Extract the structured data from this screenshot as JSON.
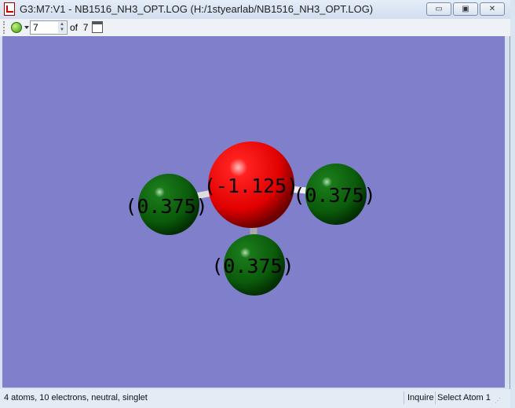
{
  "window": {
    "title": "G3:M7:V1 - NB1516_NH3_OPT.LOG (H:/1styearlab/NB1516_NH3_OPT.LOG)",
    "minimize": "▭",
    "maximize": "▣",
    "close": "✕"
  },
  "toolbar": {
    "model_icon": "green-ball-icon",
    "frame_value": "7",
    "of_label": "of",
    "frame_total": "7"
  },
  "molecule": {
    "background": "#7f7fcc",
    "atoms": [
      {
        "element": "N",
        "charge_label": "(-1.125)",
        "color": "#ff0000"
      },
      {
        "element": "H",
        "charge_label": "(0.375)",
        "color": "#0a6a0a"
      },
      {
        "element": "H",
        "charge_label": "(0.375)",
        "color": "#0a6a0a"
      },
      {
        "element": "H",
        "charge_label": "(0.375)",
        "color": "#0a6a0a"
      }
    ]
  },
  "status": {
    "info": "4 atoms, 10 electrons, neutral, singlet",
    "mode": "Inquire",
    "selection": "Select Atom 1"
  }
}
